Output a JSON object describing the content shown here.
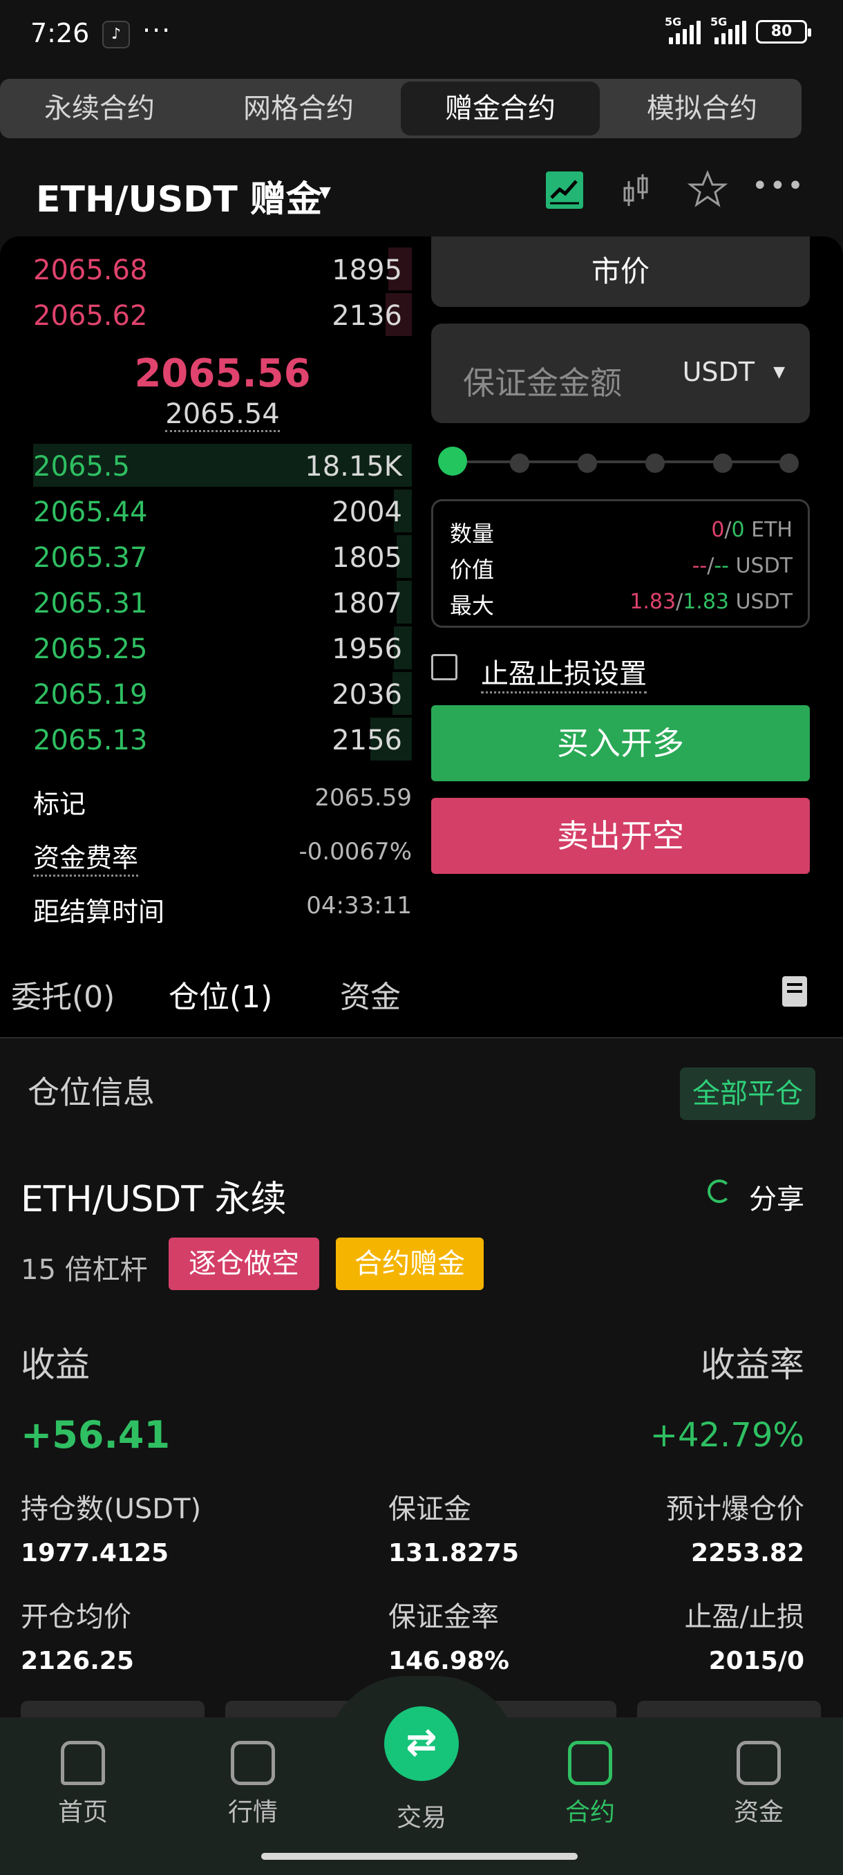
{
  "status": {
    "time": "7:26",
    "app_glyph": "♪",
    "more": "···",
    "net1": "5G",
    "net2": "5G",
    "battery": "80"
  },
  "top_tabs": [
    {
      "label": "永续合约",
      "active": false
    },
    {
      "label": "网格合约",
      "active": false
    },
    {
      "label": "赠金合约",
      "active": true
    },
    {
      "label": "模拟合约",
      "active": false
    }
  ],
  "pair": {
    "title": "ETH/USDT  赠金",
    "more": "•••"
  },
  "orderbook": {
    "asks": [
      {
        "price": "2065.68",
        "qty": "1895",
        "depth": 0.06
      },
      {
        "price": "2065.62",
        "qty": "2136",
        "depth": 0.07
      }
    ],
    "mid_price": "2065.56",
    "mark_price": "2065.54",
    "bids": [
      {
        "price": "2065.5",
        "qty": "18.15K",
        "depth": 1.0
      },
      {
        "price": "2065.44",
        "qty": "2004",
        "depth": 0.05
      },
      {
        "price": "2065.37",
        "qty": "1805",
        "depth": 0.04
      },
      {
        "price": "2065.31",
        "qty": "1807",
        "depth": 0.04
      },
      {
        "price": "2065.25",
        "qty": "1956",
        "depth": 0.05
      },
      {
        "price": "2065.19",
        "qty": "2036",
        "depth": 0.05
      },
      {
        "price": "2065.13",
        "qty": "2156",
        "depth": 0.06
      }
    ]
  },
  "info": {
    "mark_label": "标记",
    "mark_value": "2065.59",
    "funding_label": "资金费率",
    "funding_value": "-0.0067%",
    "settle_label": "距结算时间",
    "settle_value": "04:33:11"
  },
  "form": {
    "order_type": "市价",
    "amount_placeholder": "保证金金额",
    "amount_unit": "USDT",
    "slider_value": 0,
    "qty_label": "数量",
    "qty_value_a": "0",
    "qty_value_b": "0",
    "qty_unit": "ETH",
    "value_label": "价值",
    "value_a": "--",
    "value_b": "--",
    "value_unit": "USDT",
    "max_label": "最大",
    "max_a": "1.83",
    "max_b": "1.83",
    "max_unit": "USDT",
    "tpsl_label": "止盈止损设置",
    "buy_label": "买入开多",
    "sell_label": "卖出开空"
  },
  "sub_tabs": {
    "orders": "委托(0)",
    "positions": "仓位(1)",
    "funds": "资金"
  },
  "position": {
    "section_title": "仓位信息",
    "close_all": "全部平仓",
    "pair": "ETH/USDT 永续",
    "share": "分享",
    "leverage": "15 倍杠杆",
    "tag_side": "逐仓做空",
    "tag_bonus": "合约赠金",
    "pnl_label": "收益",
    "roe_label": "收益率",
    "pnl_value": "+56.41",
    "roe_value": "+42.79%",
    "size_label": "持仓数(USDT)",
    "size_value": "1977.4125",
    "margin_label": "保证金",
    "margin_value": "131.8275",
    "liq_label": "预计爆仓价",
    "liq_value": "2253.82",
    "entry_label": "开仓均价",
    "entry_value": "2126.25",
    "margin_ratio_label": "保证金率",
    "margin_ratio_value": "146.98%",
    "tpsl_label": "止盈/止损",
    "tpsl_value": "2015/0"
  },
  "nav": [
    {
      "label": "首页",
      "icon": "home-icon",
      "active": false
    },
    {
      "label": "行情",
      "icon": "market-icon",
      "active": false
    },
    {
      "label": "交易",
      "icon": "swap-icon",
      "active": false
    },
    {
      "label": "合约",
      "icon": "contract-icon",
      "active": true
    },
    {
      "label": "资金",
      "icon": "wallet-icon",
      "active": false
    }
  ],
  "colors": {
    "buy": "#29a955",
    "sell": "#d43f67",
    "bonus": "#f5b400",
    "accent": "#2fbf62"
  }
}
